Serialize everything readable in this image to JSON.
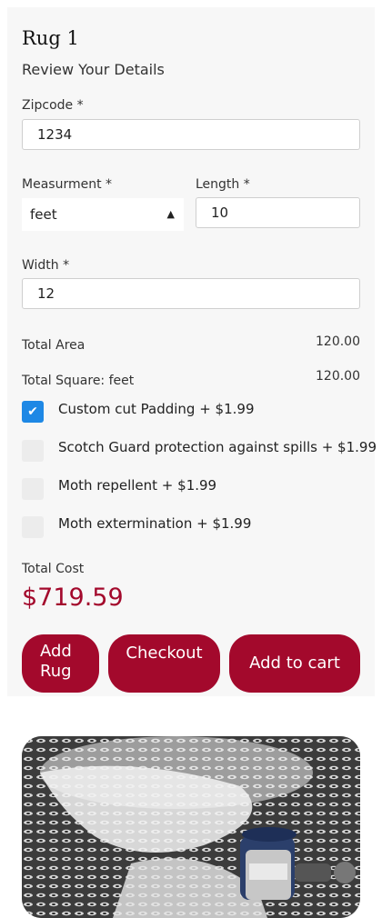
{
  "product": {
    "title": "Rug 1",
    "subtitle": "Review Your Details"
  },
  "form": {
    "zipcode_label": "Zipcode *",
    "zipcode_value": "1234",
    "measurement_label": "Measurment *",
    "measurement_value": "feet",
    "length_label": "Length *",
    "length_value": "10",
    "width_label": "Width *",
    "width_value": "12"
  },
  "summary": {
    "total_area_label": "Total Area",
    "total_area_value": "120.00",
    "total_square_label": "Total Square: feet",
    "total_square_value": "120.00"
  },
  "options": [
    {
      "label": "Custom cut Padding + $1.99",
      "checked": true
    },
    {
      "label": "Scotch Guard protection against spills + $1.99",
      "checked": false
    },
    {
      "label": "Moth repellent + $1.99",
      "checked": false
    },
    {
      "label": "Moth extermination + $1.99",
      "checked": false
    }
  ],
  "total": {
    "label": "Total Cost",
    "value": "$719.59"
  },
  "buttons": {
    "add_rug": "Add Rug",
    "checkout": "Checkout",
    "add_to_cart": "Add to cart"
  },
  "colors": {
    "accent": "#a3092c",
    "checkbox_checked": "#1e88e5"
  },
  "icons": {
    "select_caret": "updown-arrows",
    "checkmark": "check"
  }
}
